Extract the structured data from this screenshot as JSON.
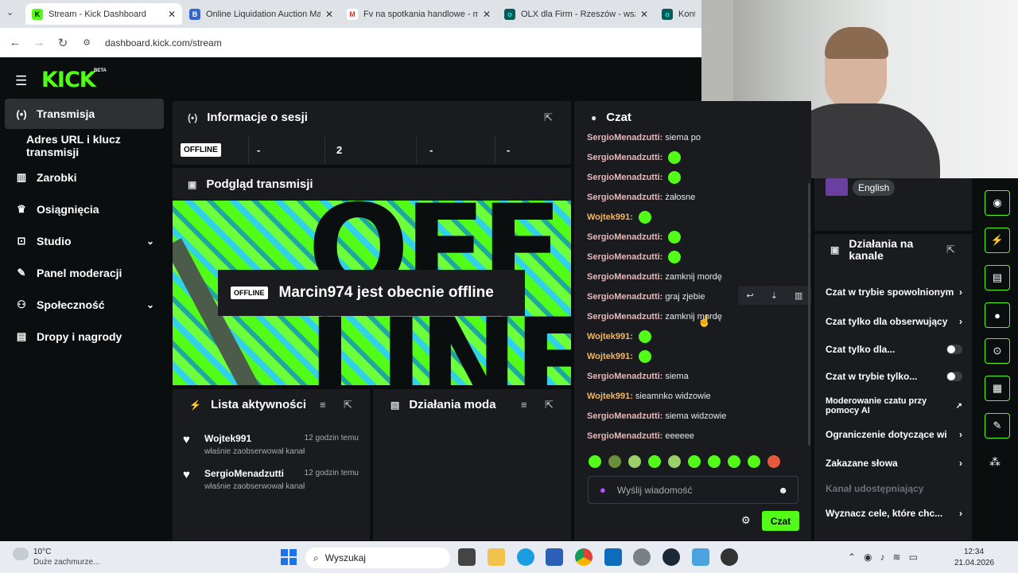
{
  "browser": {
    "tabs": [
      {
        "title": "Stream - Kick Dashboard",
        "icon": "kick-icon",
        "color": "#53fc18"
      },
      {
        "title": "Online Liquidation Auction Mar",
        "icon": "b-icon",
        "color": "#3366cc"
      },
      {
        "title": "Fv na spotkania handlowe - ma",
        "icon": "gmail-icon",
        "color": "#d93025"
      },
      {
        "title": "OLX dla Firm - Rzeszów - wszys",
        "icon": "olx-icon",
        "color": "#23e5db"
      },
      {
        "title": "Konter",
        "icon": "olx-icon",
        "color": "#23e5db"
      }
    ],
    "url": "dashboard.kick.com/stream"
  },
  "app": {
    "logo": "KICK",
    "beta": "BETA",
    "accent": "#53fc18"
  },
  "sidebar": {
    "items": [
      {
        "label": "Transmisja",
        "icon": "broadcast-icon"
      },
      {
        "label": "Adres URL i klucz transmisji"
      },
      {
        "label": "Zarobki",
        "icon": "chart-icon"
      },
      {
        "label": "Osiągnięcia",
        "icon": "trophy-icon"
      },
      {
        "label": "Studio",
        "icon": "studio-icon"
      },
      {
        "label": "Panel moderacji",
        "icon": "wrench-icon"
      },
      {
        "label": "Społeczność",
        "icon": "people-icon"
      },
      {
        "label": "Dropy i nagrody",
        "icon": "gift-icon"
      }
    ]
  },
  "session": {
    "title": "Informacje o sesji",
    "status": "OFFLINE",
    "stats": [
      "-",
      "2",
      "-",
      "-"
    ]
  },
  "preview": {
    "title": "Podgląd transmisji",
    "badge": "OFFLINE",
    "message": "Marcin974 jest obecnie offline"
  },
  "activity": {
    "title": "Lista aktywności",
    "items": [
      {
        "user": "Wojtek991",
        "time": "12 godzin temu",
        "text": "właśnie zaobserwował kanał"
      },
      {
        "user": "SergioMenadzutti",
        "time": "12 godzin temu",
        "text": "właśnie zaobserwował kanał"
      }
    ]
  },
  "modactions": {
    "title": "Działania moda"
  },
  "chat": {
    "title": "Czat",
    "messages": [
      {
        "user": "SergioMenadzutti:",
        "text": "siema po",
        "kind": "g"
      },
      {
        "user": "SergioMenadzutti:",
        "text": "",
        "kind": "g",
        "emote": true
      },
      {
        "user": "SergioMenadzutti:",
        "text": "",
        "kind": "g",
        "emote": true
      },
      {
        "user": "SergioMenadzutti:",
        "text": "żałosne",
        "kind": "g"
      },
      {
        "user": "Wojtek991:",
        "text": "",
        "kind": "y",
        "emote": true
      },
      {
        "user": "SergioMenadzutti:",
        "text": "",
        "kind": "g",
        "emote": true
      },
      {
        "user": "SergioMenadzutti:",
        "text": "",
        "kind": "g",
        "emote": true
      },
      {
        "user": "SergioMenadzutti:",
        "text": "zamknij mordę",
        "kind": "g"
      },
      {
        "user": "SergioMenadzutti:",
        "text": "graj zjebie",
        "kind": "g"
      },
      {
        "user": "SergioMenadzutti:",
        "text": "zamknij mordę",
        "kind": "g"
      },
      {
        "user": "Wojtek991:",
        "text": "",
        "kind": "y",
        "emote": true
      },
      {
        "user": "Wojtek991:",
        "text": "",
        "kind": "y",
        "emote": true
      },
      {
        "user": "SergioMenadzutti:",
        "text": "siema",
        "kind": "g"
      },
      {
        "user": "Wojtek991:",
        "text": "sieamnko widzowie",
        "kind": "y"
      },
      {
        "user": "SergioMenadzutti:",
        "text": "siema widzowie",
        "kind": "g"
      },
      {
        "user": "SergioMenadzutti:",
        "text": "eeeeee",
        "kind": "g"
      }
    ],
    "placeholder": "Wyślij wiadomość",
    "send_label": "Czat"
  },
  "language": "English",
  "channel_actions": {
    "title": "Działania na kanale",
    "items": [
      {
        "label": "Czat w trybie spowolnionym",
        "control": "chevron"
      },
      {
        "label": "Czat tylko dla obserwujący",
        "control": "chevron"
      },
      {
        "label": "Czat tylko dla...",
        "control": "toggle"
      },
      {
        "label": "Czat w trybie tylko...",
        "control": "toggle"
      },
      {
        "label": "Moderowanie czatu przy pomocy AI",
        "control": "external"
      },
      {
        "label": "Ograniczenie dotyczące wi",
        "control": "chevron"
      },
      {
        "label": "Zakazane słowa",
        "control": "chevron"
      },
      {
        "label": "Kanał udostępniający",
        "control": "none"
      },
      {
        "label": "Wyznacz cele, które chc...",
        "control": "chevron"
      }
    ]
  },
  "taskbar": {
    "weather_temp": "10°C",
    "weather_text": "Duże zachmurze...",
    "search": "Wyszukaj",
    "time": "12:34",
    "date": "21.04.2026"
  }
}
